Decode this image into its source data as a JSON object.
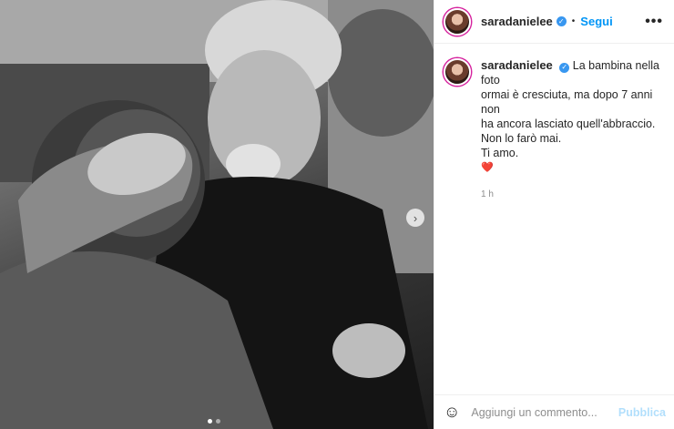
{
  "post": {
    "username": "saradanielee",
    "follow_label": "Segui",
    "more_label": "•••",
    "verified_label": "✓",
    "separator": "•",
    "caption": {
      "lines": [
        "La bambina nella foto",
        "ormai è cresciuta, ma dopo 7 anni non",
        "ha ancora lasciato quell'abbraccio.",
        "Non lo farò mai.",
        "Ti amo."
      ],
      "emoji": "❤️"
    },
    "time": "1 h"
  },
  "media": {
    "next_arrow": "›",
    "carousel_count": 2,
    "carousel_active": 0
  },
  "comment": {
    "emoji_label": "☺",
    "placeholder": "Aggiungi un commento...",
    "publish_label": "Pubblica"
  },
  "colors": {
    "follow": "#0095f6",
    "verified": "#3897f0",
    "publish_disabled": "#b2dffc"
  }
}
